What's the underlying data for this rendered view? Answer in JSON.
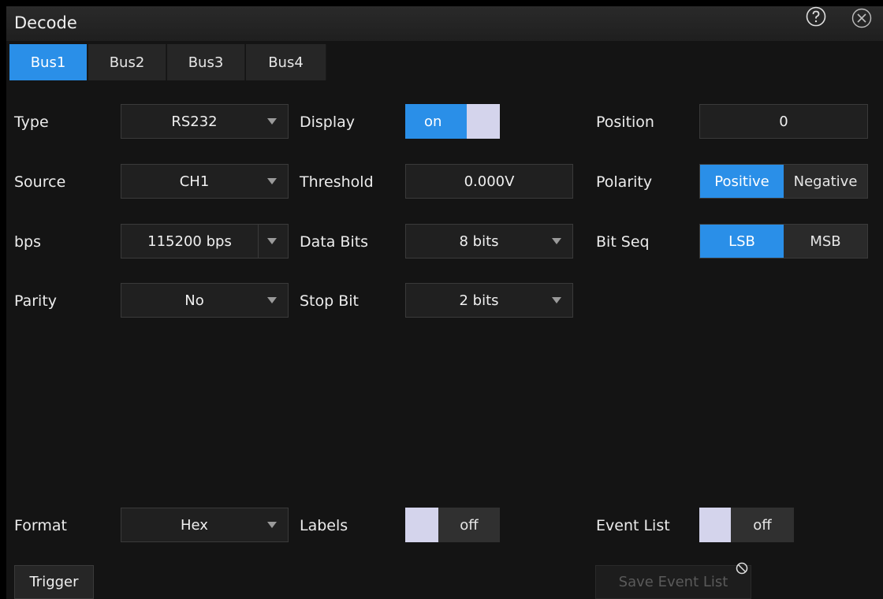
{
  "window": {
    "title": "Decode",
    "icons": {
      "help": "help-icon",
      "close": "close-icon"
    }
  },
  "tabs": [
    {
      "label": "Bus1",
      "active": true
    },
    {
      "label": "Bus2",
      "active": false
    },
    {
      "label": "Bus3",
      "active": false
    },
    {
      "label": "Bus4",
      "active": false
    }
  ],
  "fields": {
    "type": {
      "label": "Type",
      "value": "RS232"
    },
    "source": {
      "label": "Source",
      "value": "CH1"
    },
    "bps": {
      "label": "bps",
      "value": "115200 bps"
    },
    "parity": {
      "label": "Parity",
      "value": "No"
    },
    "display": {
      "label": "Display",
      "state": "on"
    },
    "threshold": {
      "label": "Threshold",
      "value": "0.000V"
    },
    "data_bits": {
      "label": "Data Bits",
      "value": "8 bits"
    },
    "stop_bit": {
      "label": "Stop Bit",
      "value": "2 bits"
    },
    "position": {
      "label": "Position",
      "value": "0"
    },
    "polarity": {
      "label": "Polarity",
      "options": [
        "Positive",
        "Negative"
      ],
      "selected": "Positive"
    },
    "bit_seq": {
      "label": "Bit Seq",
      "options": [
        "LSB",
        "MSB"
      ],
      "selected": "LSB"
    },
    "format": {
      "label": "Format",
      "value": "Hex"
    },
    "labels": {
      "label": "Labels",
      "state": "off"
    },
    "event_list": {
      "label": "Event List",
      "state": "off"
    }
  },
  "buttons": {
    "trigger": "Trigger",
    "save_event_list": "Save Event List"
  },
  "colors": {
    "accent": "#2a8fe8",
    "knob": "#d4d4ec",
    "background": "#141414"
  }
}
